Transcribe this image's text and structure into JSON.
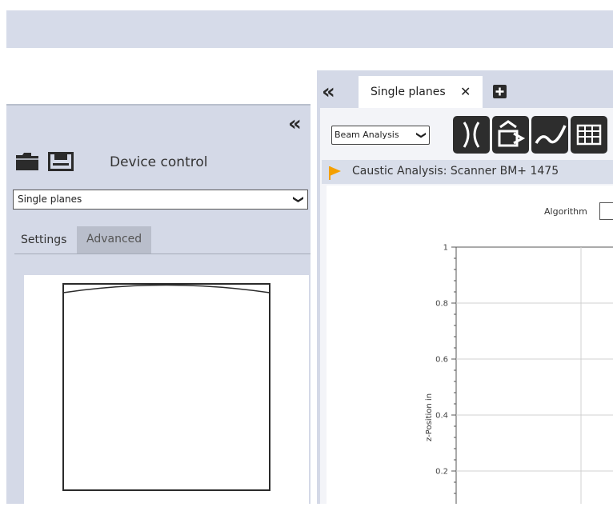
{
  "left_panel": {
    "collapse_glyph": "«",
    "title": "Device control",
    "plane_select": {
      "value": "Single planes",
      "chevron": "❯"
    },
    "tabs": [
      {
        "label": "Settings",
        "active": true
      },
      {
        "label": "Advanced",
        "active": false
      }
    ],
    "icons": [
      "folder-icon",
      "save-icon"
    ]
  },
  "right_panel": {
    "collapse_glyph": "«",
    "doc_tab": {
      "label": "Single planes",
      "close": "✕"
    },
    "add_tab_icon": "plus-icon",
    "analysis_select": {
      "value": "Beam Analysis",
      "chevron": "❯"
    },
    "toolbar_icons": [
      "caustic-icon",
      "beam-profile-icon",
      "curve-icon",
      "table-icon"
    ],
    "status": {
      "text": "Caustic Analysis: Scanner BM+ 1475",
      "flag_color": "#f4a000"
    },
    "algorithm_label": "Algorithm"
  },
  "chart_data": {
    "type": "line",
    "ylabel": "z-Position in",
    "yticks": [
      "1",
      "0.8",
      "0.6",
      "0.4",
      "0.2"
    ],
    "ylim": [
      0,
      1
    ],
    "grid": true,
    "series": []
  },
  "colors": {
    "panel_bg": "#d4d9e7",
    "topbar_bg": "#d6dbe9",
    "inactive_tab": "#b9becb",
    "icon_dark": "#2d2d2d"
  }
}
